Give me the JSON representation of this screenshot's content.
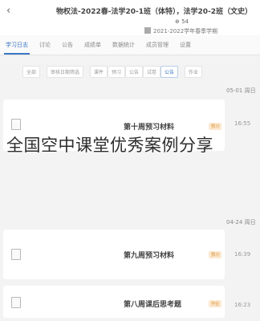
{
  "header": {
    "course_title": "物权法-2022春-法学20-1班（体特），法学20-2班（文史）",
    "teacher_line": "⊕ 54",
    "term_line": "2021-2022学年春季学期"
  },
  "tabs": [
    "学习日志",
    "讨论",
    "公告",
    "成绩单",
    "数据统计",
    "成员管理",
    "设置"
  ],
  "filters": [
    "全部",
    "课件",
    "预习",
    "公告",
    "试卷",
    "公告",
    "作业"
  ],
  "filter_right": "审核日期筛选",
  "entries": [
    {
      "date": "05-01 周日",
      "title": "第十周预习材料",
      "tag": "预习",
      "time": "16:55"
    },
    {
      "date": "04-24 周日",
      "title": "第九周预习材料",
      "tag": "预习",
      "time": "16:39"
    },
    {
      "title": "第八周课后思考题",
      "tag": "作业",
      "time": "16:23"
    }
  ],
  "watermark": "全国空中课堂优秀案例分享"
}
